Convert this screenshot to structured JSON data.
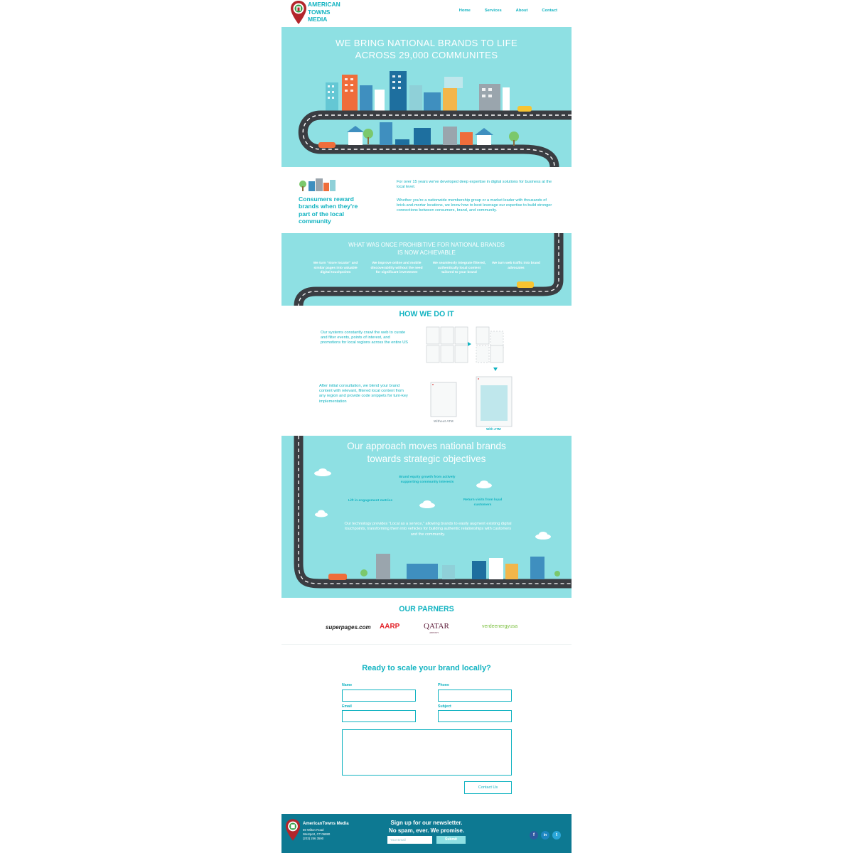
{
  "header": {
    "logo_text": "AMERICAN\nTOWNS\nMEDIA",
    "nav": [
      "Home",
      "Services",
      "About",
      "Contact"
    ]
  },
  "hero": {
    "title": "WE BRING NATIONAL BRANDS TO LIFE\nACROSS 29,000 COMMUNITES"
  },
  "intro": {
    "title": "Consumers reward\nbrands when they're\npart of the local\ncommunity",
    "paragraphs": [
      "For over 15 years we've developed deep expertise in digital solutions for business at the local level.",
      "Whether you're a nationwide membership group or a market leader with thousands of brick-and-mortar locations, we know how to best leverage our expertise to build stronger connections between consumers, brand, and community."
    ]
  },
  "achievable": {
    "title": "WHAT WAS ONCE PROHIBITIVE FOR NATIONAL BRANDS\nIS NOW ACHIEVABLE",
    "bullets": [
      "We turn \"store locator\" and similar pages into valuable digital touchpoints",
      "We improve online and mobile discoverability without the need for significant investment",
      "We seamlessly integrate filtered, authentically local content tailored to your brand",
      "We turn web traffic into brand advocates"
    ]
  },
  "how": {
    "title": "HOW WE DO IT",
    "step1": "Our systems constantly crawl the web to curate and filter events, points of interest, and promotions for local regions across the entire US",
    "step2": "After initial consultation, we blend your brand content with relevant, filtered local content from any region and provide code snippets for turn-key implementation",
    "caption_without": "Without ATM",
    "caption_with": "With ATM"
  },
  "approach": {
    "title": "Our approach moves national brands\ntowards strategic objectives",
    "objectives": [
      "Brand equity growth from actively supporting community interests",
      "Lift in engagement metrics",
      "Return visits from loyal customers"
    ],
    "paragraph": "Our technology provides \"Local as a service,\" allowing brands to easily augment existing digital touchpoints, transforming them into vehicles for building authentic relationships with customers and the community."
  },
  "partners": {
    "title": "OUR PARNERS",
    "logos": [
      "superpages.com",
      "AARP",
      "QATAR",
      "verdeenergyusa"
    ],
    "qatar_sub": "AIRWAYS"
  },
  "contact": {
    "title": "Ready to scale your brand locally?",
    "labels": {
      "name": "Name",
      "phone": "Phone",
      "email": "Email",
      "subject": "Subject"
    },
    "button": "Contact Us"
  },
  "footer": {
    "company": "AmericanTowns Media",
    "address": [
      "59 Wilton Road",
      "Westport, CT 06880",
      "(203) 256 3590"
    ],
    "newsletter": "Sign up for our newsletter.\nNo spam, ever. We promise.",
    "email_placeholder": "Your Email",
    "submit": "Submit",
    "social": [
      "f",
      "in",
      "t"
    ]
  },
  "colors": {
    "teal": "#11b3c1",
    "sky": "#8ee0e3",
    "footer": "#0d7992",
    "road": "#3a3d42"
  }
}
